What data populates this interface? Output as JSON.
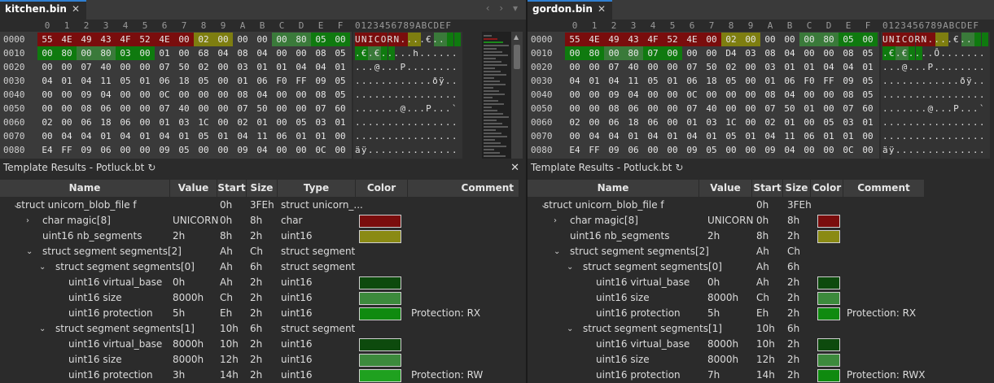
{
  "colors": {
    "red": "#7a0d0d",
    "olive": "#8a8a14",
    "dkgreen": "#0d4a0d",
    "ltgreen": "#3c8a3c",
    "green": "#0f8a0f",
    "brightgreen": "#1fa11f"
  },
  "hex_columns": [
    "0",
    "1",
    "2",
    "3",
    "4",
    "5",
    "6",
    "7",
    "8",
    "9",
    "A",
    "B",
    "C",
    "D",
    "E",
    "F"
  ],
  "ascii_header": "0123456789ABCDEF",
  "left": {
    "tab": {
      "label": "kitchen.bin",
      "close": "✕"
    },
    "nav": "‹ › ▾",
    "rows": [
      {
        "addr": "0000",
        "bytes": [
          "55",
          "4E",
          "49",
          "43",
          "4F",
          "52",
          "4E",
          "00",
          "02",
          "00",
          "00",
          "00",
          "00",
          "80",
          "05",
          "00"
        ],
        "ascii": "UNICORN....€..",
        "hl": [
          "r",
          "r",
          "r",
          "r",
          "r",
          "r",
          "r",
          "r",
          "y",
          "y",
          "",
          "",
          "lg",
          "lg",
          "g",
          "g"
        ]
      },
      {
        "addr": "0010",
        "bytes": [
          "00",
          "80",
          "00",
          "80",
          "03",
          "00",
          "01",
          "00",
          "68",
          "04",
          "08",
          "04",
          "00",
          "00",
          "08",
          "05"
        ],
        "ascii": ".€.€.....h......",
        "hl": [
          "g",
          "g",
          "lg",
          "lg",
          "g",
          "g",
          "",
          "",
          "",
          "",
          "",
          "",
          "",
          "",
          "",
          ""
        ]
      },
      {
        "addr": "0020",
        "bytes": [
          "00",
          "00",
          "07",
          "40",
          "00",
          "00",
          "07",
          "50",
          "02",
          "00",
          "03",
          "01",
          "01",
          "04",
          "04",
          "01"
        ],
        "ascii": "...@...P........",
        "hl": []
      },
      {
        "addr": "0030",
        "bytes": [
          "04",
          "01",
          "04",
          "11",
          "05",
          "01",
          "06",
          "18",
          "05",
          "00",
          "01",
          "06",
          "F0",
          "FF",
          "09",
          "05"
        ],
        "ascii": "............ðÿ..",
        "hl": []
      },
      {
        "addr": "0040",
        "bytes": [
          "00",
          "00",
          "09",
          "04",
          "00",
          "00",
          "0C",
          "00",
          "00",
          "00",
          "08",
          "04",
          "00",
          "00",
          "08",
          "05"
        ],
        "ascii": "................",
        "hl": []
      },
      {
        "addr": "0050",
        "bytes": [
          "00",
          "00",
          "08",
          "06",
          "00",
          "00",
          "07",
          "40",
          "00",
          "00",
          "07",
          "50",
          "00",
          "00",
          "07",
          "60"
        ],
        "ascii": ".......@...P...`",
        "hl": []
      },
      {
        "addr": "0060",
        "bytes": [
          "02",
          "00",
          "06",
          "18",
          "06",
          "00",
          "01",
          "03",
          "1C",
          "00",
          "02",
          "01",
          "00",
          "05",
          "03",
          "01"
        ],
        "ascii": "................",
        "hl": []
      },
      {
        "addr": "0070",
        "bytes": [
          "00",
          "04",
          "04",
          "01",
          "04",
          "01",
          "04",
          "01",
          "05",
          "01",
          "04",
          "11",
          "06",
          "01",
          "01",
          "00"
        ],
        "ascii": "................",
        "hl": []
      },
      {
        "addr": "0080",
        "bytes": [
          "E4",
          "FF",
          "09",
          "06",
          "00",
          "00",
          "09",
          "05",
          "00",
          "00",
          "09",
          "04",
          "00",
          "00",
          "0C",
          "00"
        ],
        "ascii": "äÿ..............",
        "hl": []
      }
    ],
    "template": {
      "title": "Template Results - Potluck.bt",
      "refresh": "↻",
      "close": "✕",
      "headers": {
        "name": "Name",
        "value": "Value",
        "start": "Start",
        "size": "Size",
        "type": "Type",
        "color": "Color",
        "comment": "Comment"
      },
      "rows": [
        {
          "indent": 0,
          "chev": "⌄",
          "name": "struct unicorn_blob_file f",
          "value": "",
          "start": "0h",
          "size": "3FEh",
          "type": "struct unicorn_...",
          "color": "",
          "comment": ""
        },
        {
          "indent": 1,
          "chev": "›",
          "name": "char magic[8]",
          "value": "UNICORN",
          "start": "0h",
          "size": "8h",
          "type": "char",
          "color": "red",
          "comment": ""
        },
        {
          "indent": 1,
          "chev": "",
          "name": "uint16 nb_segments",
          "value": "2h",
          "start": "8h",
          "size": "2h",
          "type": "uint16",
          "color": "olive",
          "comment": ""
        },
        {
          "indent": 1,
          "chev": "⌄",
          "name": "struct segment segments[2]",
          "value": "",
          "start": "Ah",
          "size": "Ch",
          "type": "struct segment",
          "color": "",
          "comment": ""
        },
        {
          "indent": 2,
          "chev": "⌄",
          "name": "struct segment segments[0]",
          "value": "",
          "start": "Ah",
          "size": "6h",
          "type": "struct segment",
          "color": "",
          "comment": ""
        },
        {
          "indent": 3,
          "chev": "",
          "name": "uint16 virtual_base",
          "value": "0h",
          "start": "Ah",
          "size": "2h",
          "type": "uint16",
          "color": "dkgreen",
          "comment": ""
        },
        {
          "indent": 3,
          "chev": "",
          "name": "uint16 size",
          "value": "8000h",
          "start": "Ch",
          "size": "2h",
          "type": "uint16",
          "color": "ltgreen",
          "comment": ""
        },
        {
          "indent": 3,
          "chev": "",
          "name": "uint16 protection",
          "value": "5h",
          "start": "Eh",
          "size": "2h",
          "type": "uint16",
          "color": "green",
          "comment": "Protection: RX"
        },
        {
          "indent": 2,
          "chev": "⌄",
          "name": "struct segment segments[1]",
          "value": "",
          "start": "10h",
          "size": "6h",
          "type": "struct segment",
          "color": "",
          "comment": ""
        },
        {
          "indent": 3,
          "chev": "",
          "name": "uint16 virtual_base",
          "value": "8000h",
          "start": "10h",
          "size": "2h",
          "type": "uint16",
          "color": "dkgreen",
          "comment": ""
        },
        {
          "indent": 3,
          "chev": "",
          "name": "uint16 size",
          "value": "8000h",
          "start": "12h",
          "size": "2h",
          "type": "uint16",
          "color": "ltgreen",
          "comment": ""
        },
        {
          "indent": 3,
          "chev": "",
          "name": "uint16 protection",
          "value": "3h",
          "start": "14h",
          "size": "2h",
          "type": "uint16",
          "color": "brightgreen",
          "comment": "Protection: RW"
        }
      ]
    }
  },
  "right": {
    "tab": {
      "label": "gordon.bin",
      "close": "✕"
    },
    "rows": [
      {
        "addr": "0000",
        "bytes": [
          "55",
          "4E",
          "49",
          "43",
          "4F",
          "52",
          "4E",
          "00",
          "02",
          "00",
          "00",
          "00",
          "00",
          "80",
          "05",
          "00"
        ],
        "ascii": "UNICORN....€..",
        "hl": [
          "r",
          "r",
          "r",
          "r",
          "r",
          "r",
          "r",
          "r",
          "y",
          "y",
          "",
          "",
          "lg",
          "lg",
          "g",
          "g"
        ]
      },
      {
        "addr": "0010",
        "bytes": [
          "00",
          "80",
          "00",
          "80",
          "07",
          "00",
          "00",
          "00",
          "D4",
          "03",
          "08",
          "04",
          "00",
          "00",
          "08",
          "05"
        ],
        "ascii": ".€.€....Ô.......",
        "hl": [
          "g",
          "g",
          "lg",
          "lg",
          "g",
          "g",
          "",
          "",
          "",
          "",
          "",
          "",
          "",
          "",
          "",
          ""
        ]
      },
      {
        "addr": "0020",
        "bytes": [
          "00",
          "00",
          "07",
          "40",
          "00",
          "00",
          "07",
          "50",
          "02",
          "00",
          "03",
          "01",
          "01",
          "04",
          "04",
          "01"
        ],
        "ascii": "...@...P........",
        "hl": []
      },
      {
        "addr": "0030",
        "bytes": [
          "04",
          "01",
          "04",
          "11",
          "05",
          "01",
          "06",
          "18",
          "05",
          "00",
          "01",
          "06",
          "F0",
          "FF",
          "09",
          "05"
        ],
        "ascii": "............ðÿ..",
        "hl": []
      },
      {
        "addr": "0040",
        "bytes": [
          "00",
          "00",
          "09",
          "04",
          "00",
          "00",
          "0C",
          "00",
          "00",
          "00",
          "08",
          "04",
          "00",
          "00",
          "08",
          "05"
        ],
        "ascii": "................",
        "hl": []
      },
      {
        "addr": "0050",
        "bytes": [
          "00",
          "00",
          "08",
          "06",
          "00",
          "00",
          "07",
          "40",
          "00",
          "00",
          "07",
          "50",
          "01",
          "00",
          "07",
          "60"
        ],
        "ascii": ".......@...P...`",
        "hl": []
      },
      {
        "addr": "0060",
        "bytes": [
          "02",
          "00",
          "06",
          "18",
          "06",
          "00",
          "01",
          "03",
          "1C",
          "00",
          "02",
          "01",
          "00",
          "05",
          "03",
          "01"
        ],
        "ascii": "................",
        "hl": []
      },
      {
        "addr": "0070",
        "bytes": [
          "00",
          "04",
          "04",
          "01",
          "04",
          "01",
          "04",
          "01",
          "05",
          "01",
          "04",
          "11",
          "06",
          "01",
          "01",
          "00"
        ],
        "ascii": "................",
        "hl": []
      },
      {
        "addr": "0080",
        "bytes": [
          "E4",
          "FF",
          "09",
          "06",
          "00",
          "00",
          "09",
          "05",
          "00",
          "00",
          "09",
          "04",
          "00",
          "00",
          "0C",
          "00"
        ],
        "ascii": "äÿ..............",
        "hl": []
      }
    ],
    "template": {
      "title": "Template Results - Potluck.bt",
      "refresh": "↻",
      "headers": {
        "name": "Name",
        "value": "Value",
        "start": "Start",
        "size": "Size",
        "color": "Color",
        "comment": "Comment"
      },
      "rows": [
        {
          "indent": 0,
          "chev": "⌄",
          "name": "struct unicorn_blob_file f",
          "value": "",
          "start": "0h",
          "size": "3FEh",
          "color": "",
          "comment": ""
        },
        {
          "indent": 1,
          "chev": "›",
          "name": "char magic[8]",
          "value": "UNICORN",
          "start": "0h",
          "size": "8h",
          "color": "red",
          "comment": ""
        },
        {
          "indent": 1,
          "chev": "",
          "name": "uint16 nb_segments",
          "value": "2h",
          "start": "8h",
          "size": "2h",
          "color": "olive",
          "comment": ""
        },
        {
          "indent": 1,
          "chev": "⌄",
          "name": "struct segment segments[2]",
          "value": "",
          "start": "Ah",
          "size": "Ch",
          "color": "",
          "comment": ""
        },
        {
          "indent": 2,
          "chev": "⌄",
          "name": "struct segment segments[0]",
          "value": "",
          "start": "Ah",
          "size": "6h",
          "color": "",
          "comment": ""
        },
        {
          "indent": 3,
          "chev": "",
          "name": "uint16 virtual_base",
          "value": "0h",
          "start": "Ah",
          "size": "2h",
          "color": "dkgreen",
          "comment": ""
        },
        {
          "indent": 3,
          "chev": "",
          "name": "uint16 size",
          "value": "8000h",
          "start": "Ch",
          "size": "2h",
          "color": "ltgreen",
          "comment": ""
        },
        {
          "indent": 3,
          "chev": "",
          "name": "uint16 protection",
          "value": "5h",
          "start": "Eh",
          "size": "2h",
          "color": "green",
          "comment": "Protection: RX"
        },
        {
          "indent": 2,
          "chev": "⌄",
          "name": "struct segment segments[1]",
          "value": "",
          "start": "10h",
          "size": "6h",
          "color": "",
          "comment": ""
        },
        {
          "indent": 3,
          "chev": "",
          "name": "uint16 virtual_base",
          "value": "8000h",
          "start": "10h",
          "size": "2h",
          "color": "dkgreen",
          "comment": ""
        },
        {
          "indent": 3,
          "chev": "",
          "name": "uint16 size",
          "value": "8000h",
          "start": "12h",
          "size": "2h",
          "color": "ltgreen",
          "comment": ""
        },
        {
          "indent": 3,
          "chev": "",
          "name": "uint16 protection",
          "value": "7h",
          "start": "14h",
          "size": "2h",
          "color": "green",
          "comment": "Protection: RWX"
        }
      ]
    }
  }
}
